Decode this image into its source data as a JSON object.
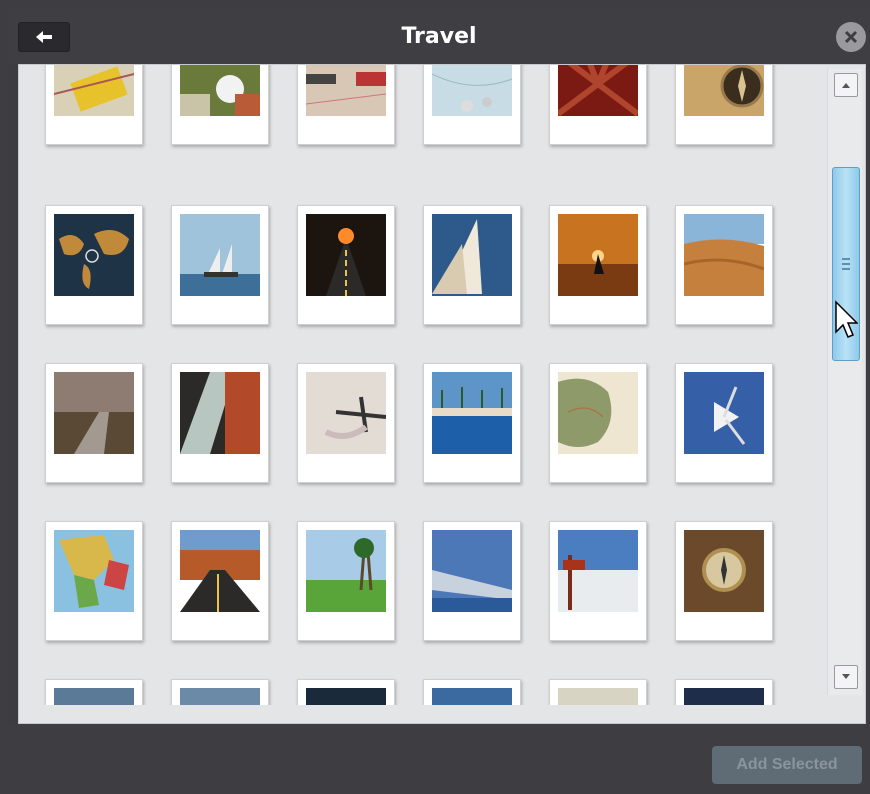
{
  "header": {
    "title": "Travel",
    "back_icon": "arrow-left-icon",
    "close_icon": "close-icon"
  },
  "footer": {
    "add_selected_label": "Add Selected"
  },
  "scrollbar": {
    "up_icon": "scroll-up-icon",
    "down_icon": "scroll-down-icon"
  },
  "colors": {
    "title_bar": "#3f3e43",
    "panel": "#e4e5e7",
    "scroll_thumb": "#9fd4f0",
    "button_disabled": "#5f6b75"
  },
  "images": [
    {
      "subject": "yellow car on map"
    },
    {
      "subject": "travel essentials"
    },
    {
      "subject": "keys and passport"
    },
    {
      "subject": "map with coins"
    },
    {
      "subject": "red world map"
    },
    {
      "subject": "compass on map"
    },
    {
      "subject": "dark world map"
    },
    {
      "subject": "sailing ship"
    },
    {
      "subject": "road at sunset"
    },
    {
      "subject": "sailboat"
    },
    {
      "subject": "boat at sunset"
    },
    {
      "subject": "desert dunes"
    },
    {
      "subject": "winding road"
    },
    {
      "subject": "building"
    },
    {
      "subject": "airplane shadow"
    },
    {
      "subject": "palm pool"
    },
    {
      "subject": "antique map"
    },
    {
      "subject": "seagull"
    },
    {
      "subject": "globe"
    },
    {
      "subject": "canyon road"
    },
    {
      "subject": "palm trees"
    },
    {
      "subject": "airplane wing"
    },
    {
      "subject": "signpost on beach"
    },
    {
      "subject": "pocket compass"
    },
    {
      "subject": "partial"
    },
    {
      "subject": "partial"
    },
    {
      "subject": "partial"
    },
    {
      "subject": "partial"
    },
    {
      "subject": "partial"
    },
    {
      "subject": "partial"
    }
  ]
}
